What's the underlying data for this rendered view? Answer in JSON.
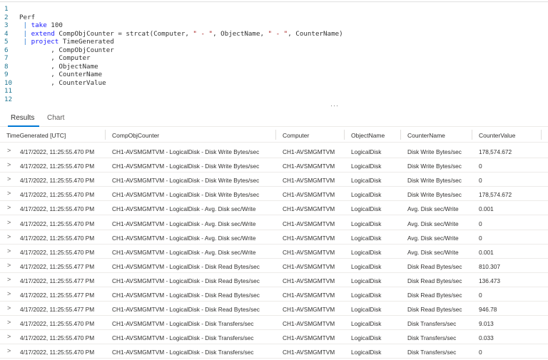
{
  "editor": {
    "lines": [
      {
        "n": "1",
        "segments": []
      },
      {
        "n": "2",
        "segments": [
          {
            "t": "Perf",
            "c": ""
          }
        ]
      },
      {
        "n": "3",
        "segments": [
          {
            "t": " | ",
            "c": "pipe"
          },
          {
            "t": "take",
            "c": "kw"
          },
          {
            "t": " 100",
            "c": ""
          }
        ]
      },
      {
        "n": "4",
        "segments": [
          {
            "t": " | ",
            "c": "pipe"
          },
          {
            "t": "extend",
            "c": "kw"
          },
          {
            "t": " CompObjCounter = strcat(Computer, ",
            "c": ""
          },
          {
            "t": "\" - \"",
            "c": "str"
          },
          {
            "t": ", ObjectName, ",
            "c": ""
          },
          {
            "t": "\" - \"",
            "c": "str"
          },
          {
            "t": ", CounterName)",
            "c": ""
          }
        ]
      },
      {
        "n": "5",
        "segments": [
          {
            "t": " | ",
            "c": "pipe"
          },
          {
            "t": "project",
            "c": "kw"
          },
          {
            "t": " TimeGenerated",
            "c": ""
          }
        ]
      },
      {
        "n": "6",
        "segments": [
          {
            "t": "        , CompObjCounter",
            "c": ""
          }
        ]
      },
      {
        "n": "7",
        "segments": [
          {
            "t": "        , Computer",
            "c": ""
          }
        ]
      },
      {
        "n": "8",
        "segments": [
          {
            "t": "        , ObjectName",
            "c": ""
          }
        ]
      },
      {
        "n": "9",
        "segments": [
          {
            "t": "        , CounterName",
            "c": ""
          }
        ]
      },
      {
        "n": "10",
        "segments": [
          {
            "t": "        , CounterValue",
            "c": ""
          }
        ]
      },
      {
        "n": "11",
        "segments": []
      },
      {
        "n": "12",
        "segments": []
      }
    ],
    "resize_grip": "···"
  },
  "tabs": {
    "results": "Results",
    "chart": "Chart"
  },
  "table": {
    "columns": [
      "TimeGenerated [UTC]",
      "CompObjCounter",
      "Computer",
      "ObjectName",
      "CounterName",
      "CounterValue"
    ],
    "expand_glyph": ">",
    "rows": [
      [
        "4/17/2022, 11:25:55.470 PM",
        "CH1-AVSMGMTVM - LogicalDisk - Disk Write Bytes/sec",
        "CH1-AVSMGMTVM",
        "LogicalDisk",
        "Disk Write Bytes/sec",
        "178,574.672"
      ],
      [
        "4/17/2022, 11:25:55.470 PM",
        "CH1-AVSMGMTVM - LogicalDisk - Disk Write Bytes/sec",
        "CH1-AVSMGMTVM",
        "LogicalDisk",
        "Disk Write Bytes/sec",
        "0"
      ],
      [
        "4/17/2022, 11:25:55.470 PM",
        "CH1-AVSMGMTVM - LogicalDisk - Disk Write Bytes/sec",
        "CH1-AVSMGMTVM",
        "LogicalDisk",
        "Disk Write Bytes/sec",
        "0"
      ],
      [
        "4/17/2022, 11:25:55.470 PM",
        "CH1-AVSMGMTVM - LogicalDisk - Disk Write Bytes/sec",
        "CH1-AVSMGMTVM",
        "LogicalDisk",
        "Disk Write Bytes/sec",
        "178,574.672"
      ],
      [
        "4/17/2022, 11:25:55.470 PM",
        "CH1-AVSMGMTVM - LogicalDisk - Avg. Disk sec/Write",
        "CH1-AVSMGMTVM",
        "LogicalDisk",
        "Avg. Disk sec/Write",
        "0.001"
      ],
      [
        "4/17/2022, 11:25:55.470 PM",
        "CH1-AVSMGMTVM - LogicalDisk - Avg. Disk sec/Write",
        "CH1-AVSMGMTVM",
        "LogicalDisk",
        "Avg. Disk sec/Write",
        "0"
      ],
      [
        "4/17/2022, 11:25:55.470 PM",
        "CH1-AVSMGMTVM - LogicalDisk - Avg. Disk sec/Write",
        "CH1-AVSMGMTVM",
        "LogicalDisk",
        "Avg. Disk sec/Write",
        "0"
      ],
      [
        "4/17/2022, 11:25:55.470 PM",
        "CH1-AVSMGMTVM - LogicalDisk - Avg. Disk sec/Write",
        "CH1-AVSMGMTVM",
        "LogicalDisk",
        "Avg. Disk sec/Write",
        "0.001"
      ],
      [
        "4/17/2022, 11:25:55.477 PM",
        "CH1-AVSMGMTVM - LogicalDisk - Disk Read Bytes/sec",
        "CH1-AVSMGMTVM",
        "LogicalDisk",
        "Disk Read Bytes/sec",
        "810.307"
      ],
      [
        "4/17/2022, 11:25:55.477 PM",
        "CH1-AVSMGMTVM - LogicalDisk - Disk Read Bytes/sec",
        "CH1-AVSMGMTVM",
        "LogicalDisk",
        "Disk Read Bytes/sec",
        "136.473"
      ],
      [
        "4/17/2022, 11:25:55.477 PM",
        "CH1-AVSMGMTVM - LogicalDisk - Disk Read Bytes/sec",
        "CH1-AVSMGMTVM",
        "LogicalDisk",
        "Disk Read Bytes/sec",
        "0"
      ],
      [
        "4/17/2022, 11:25:55.477 PM",
        "CH1-AVSMGMTVM - LogicalDisk - Disk Read Bytes/sec",
        "CH1-AVSMGMTVM",
        "LogicalDisk",
        "Disk Read Bytes/sec",
        "946.78"
      ],
      [
        "4/17/2022, 11:25:55.470 PM",
        "CH1-AVSMGMTVM - LogicalDisk - Disk Transfers/sec",
        "CH1-AVSMGMTVM",
        "LogicalDisk",
        "Disk Transfers/sec",
        "9.013"
      ],
      [
        "4/17/2022, 11:25:55.470 PM",
        "CH1-AVSMGMTVM - LogicalDisk - Disk Transfers/sec",
        "CH1-AVSMGMTVM",
        "LogicalDisk",
        "Disk Transfers/sec",
        "0.033"
      ],
      [
        "4/17/2022, 11:25:55.470 PM",
        "CH1-AVSMGMTVM - LogicalDisk - Disk Transfers/sec",
        "CH1-AVSMGMTVM",
        "LogicalDisk",
        "Disk Transfers/sec",
        "0"
      ]
    ]
  }
}
